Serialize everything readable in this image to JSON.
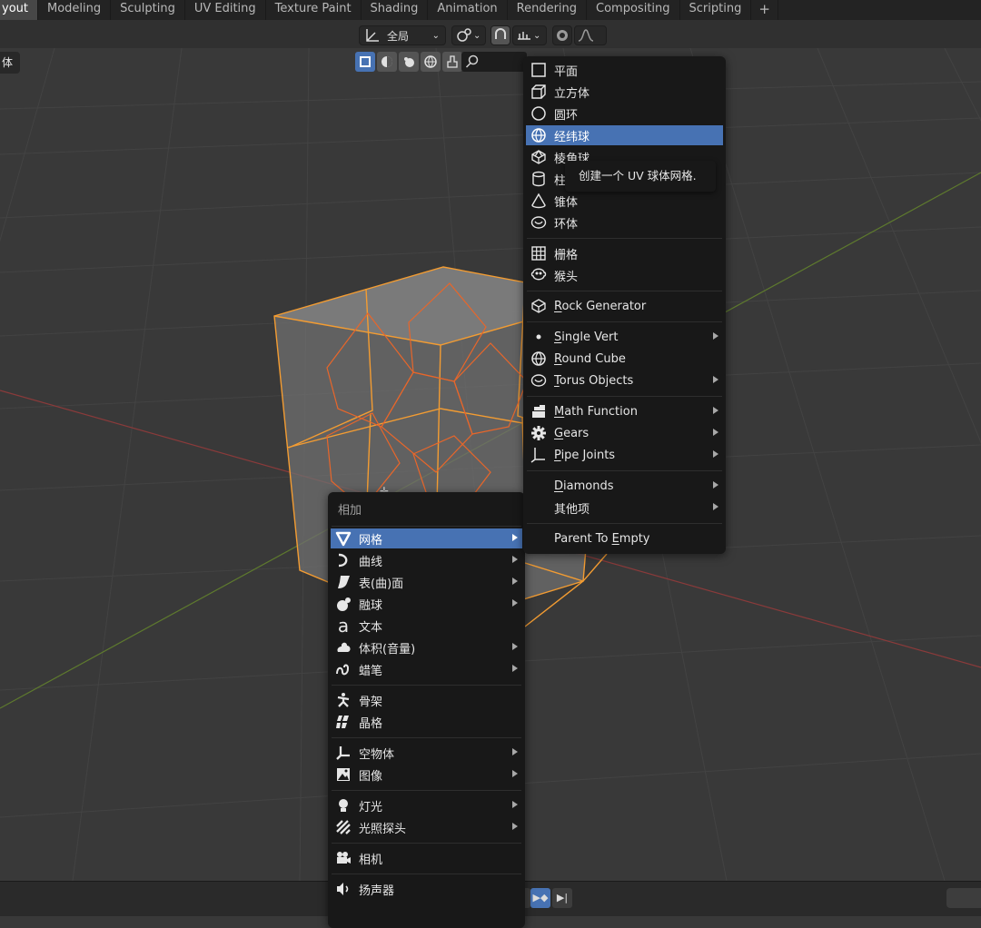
{
  "workspace_tabs": [
    "yout",
    "Modeling",
    "Sculpting",
    "UV Editing",
    "Texture Paint",
    "Shading",
    "Animation",
    "Rendering",
    "Compositing",
    "Scripting"
  ],
  "header": {
    "orientation_label": "全局",
    "side_tab_label": "体"
  },
  "add_menu": {
    "title": "相加",
    "groups": [
      [
        {
          "label": "网格",
          "icon": "mesh-icon",
          "submenu": true,
          "highlighted": true
        },
        {
          "label": "曲线",
          "icon": "curve-icon",
          "submenu": true
        },
        {
          "label": "表(曲)面",
          "icon": "surface-icon",
          "submenu": true
        },
        {
          "label": "融球",
          "icon": "metaball-icon",
          "submenu": true
        },
        {
          "label": "文本",
          "icon": "text-icon",
          "submenu": false
        },
        {
          "label": "体积(音量)",
          "icon": "volume-icon",
          "submenu": true
        },
        {
          "label": "蜡笔",
          "icon": "grease-pencil-icon",
          "submenu": true
        }
      ],
      [
        {
          "label": "骨架",
          "icon": "armature-icon",
          "submenu": false
        },
        {
          "label": "晶格",
          "icon": "lattice-icon",
          "submenu": false
        }
      ],
      [
        {
          "label": "空物体",
          "icon": "empty-icon",
          "submenu": true
        },
        {
          "label": "图像",
          "icon": "image-icon",
          "submenu": true
        }
      ],
      [
        {
          "label": "灯光",
          "icon": "light-icon",
          "submenu": true
        },
        {
          "label": "光照探头",
          "icon": "light-probe-icon",
          "submenu": true
        }
      ],
      [
        {
          "label": "相机",
          "icon": "camera-icon",
          "submenu": false
        }
      ],
      [
        {
          "label": "扬声器",
          "icon": "speaker-icon",
          "submenu": false
        }
      ]
    ]
  },
  "mesh_menu": {
    "groups": [
      [
        {
          "label": "平面",
          "icon": "plane-icon"
        },
        {
          "label": "立方体",
          "icon": "cube-icon"
        },
        {
          "label": "圆环",
          "icon": "circle-icon"
        },
        {
          "label": "经纬球",
          "icon": "uv-sphere-icon",
          "highlighted": true
        },
        {
          "label": "棱角球",
          "icon": "ico-sphere-icon"
        },
        {
          "label": "柱",
          "icon": "cylinder-icon"
        },
        {
          "label": "锥体",
          "icon": "cone-icon"
        },
        {
          "label": "环体",
          "icon": "torus-icon"
        }
      ],
      [
        {
          "label": "栅格",
          "icon": "grid-icon"
        },
        {
          "label": "猴头",
          "icon": "monkey-icon"
        }
      ],
      [
        {
          "label_u": "R",
          "label_rest": "ock Generator",
          "icon": "rock-icon"
        }
      ],
      [
        {
          "label_u": "S",
          "label_rest": "ingle Vert",
          "icon": "vertex-icon",
          "submenu": true
        },
        {
          "label_u": "R",
          "label_rest": "ound Cube",
          "icon": "round-cube-icon"
        },
        {
          "label_u": "T",
          "label_rest": "orus Objects",
          "icon": "torus-objects-icon",
          "submenu": true
        }
      ],
      [
        {
          "label_u": "M",
          "label_rest": "ath Function",
          "icon": "math-function-icon",
          "submenu": true
        },
        {
          "label_u": "G",
          "label_rest": "ears",
          "icon": "gear-icon",
          "submenu": true
        },
        {
          "label_u": "P",
          "label_rest": "ipe Joints",
          "icon": "pipe-icon",
          "submenu": true
        }
      ],
      [
        {
          "label_u": "D",
          "label_rest": "iamonds",
          "icon": "",
          "submenu": true
        },
        {
          "label": "其他项",
          "icon": "",
          "submenu": true
        }
      ],
      [
        {
          "label_u": "",
          "label_rest": "Parent To ",
          "label_u2": "E",
          "label_rest2": "mpty",
          "icon": ""
        }
      ]
    ]
  },
  "tooltip": "创建一个 UV 球体网格."
}
